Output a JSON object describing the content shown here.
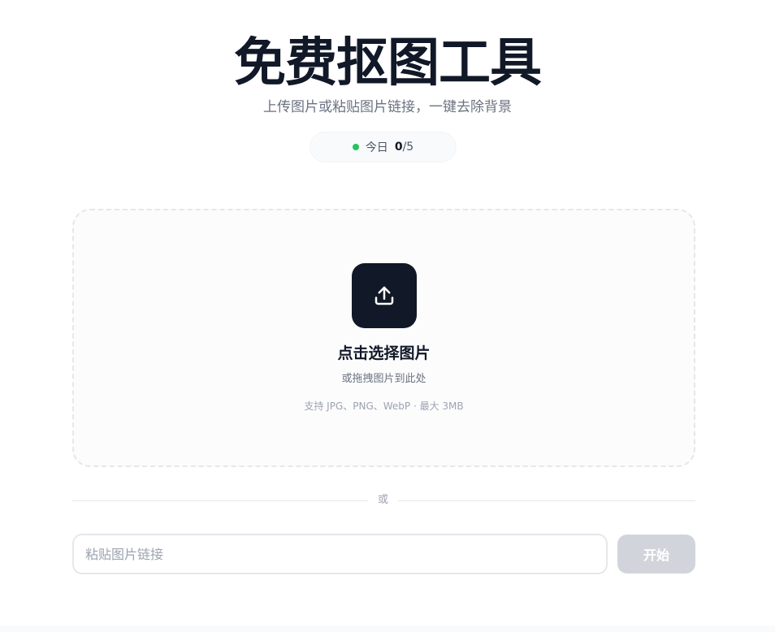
{
  "header": {
    "title": "免费抠图工具",
    "subtitle": "上传图片或粘贴图片链接，一键去除背景"
  },
  "quota": {
    "label": "今日",
    "used": "0",
    "limit": "/5",
    "status_color": "#22c55e"
  },
  "dropzone": {
    "icon": "upload-icon",
    "title": "点击选择图片",
    "subtitle": "或拖拽图片到此处",
    "hint": "支持 JPG、PNG、WebP · 最大 3MB"
  },
  "divider": {
    "text": "或"
  },
  "url_form": {
    "placeholder": "粘贴图片链接",
    "value": "",
    "submit_label": "开始"
  },
  "colors": {
    "primary": "#111827",
    "muted": "#6b7280",
    "disabled_button": "#d1d5db"
  }
}
